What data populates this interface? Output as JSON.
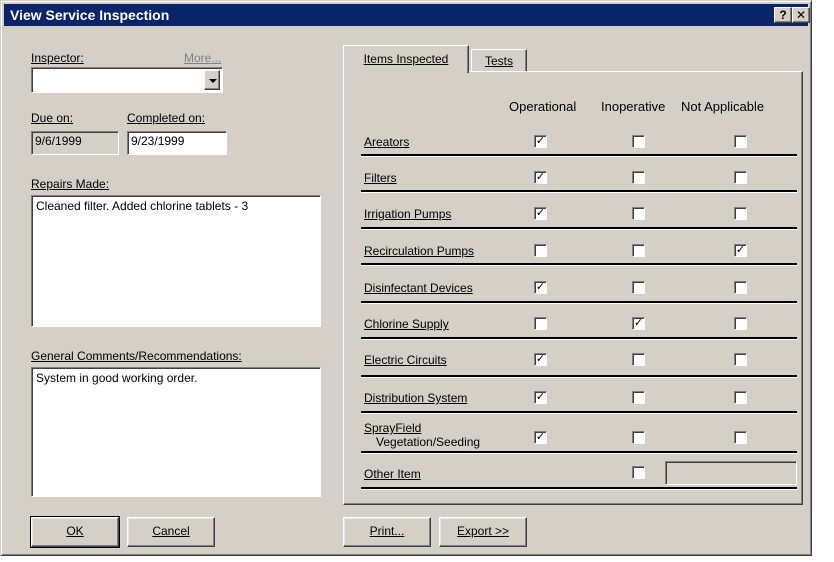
{
  "window": {
    "title": "View Service Inspection",
    "help_label": "?",
    "close_label": "✕"
  },
  "form": {
    "inspector_label": "Inspector:",
    "more_link": "More...",
    "inspector_value": "",
    "due_label": "Due on:",
    "due_value": "9/6/1999",
    "completed_label": "Completed on:",
    "completed_value": "9/23/1999",
    "repairs_label": "Repairs Made:",
    "repairs_value": "Cleaned filter.  Added chlorine tablets - 3",
    "comments_label": "General Comments/Recommendations:",
    "comments_value": "System in good working order."
  },
  "tabs": [
    {
      "label": "Items Inspected",
      "active": true
    },
    {
      "label": "Tests",
      "active": false
    }
  ],
  "columns": [
    "Operational",
    "Inoperative",
    "Not Applicable"
  ],
  "items": [
    {
      "label": "Areators",
      "operational": true,
      "inoperative": false,
      "not_applicable": false
    },
    {
      "label": "Filters",
      "operational": true,
      "inoperative": false,
      "not_applicable": false
    },
    {
      "label": "Irrigation Pumps",
      "operational": true,
      "inoperative": false,
      "not_applicable": false
    },
    {
      "label": "Recirculation Pumps",
      "operational": false,
      "inoperative": false,
      "not_applicable": true
    },
    {
      "label": "Disinfectant Devices",
      "operational": true,
      "inoperative": false,
      "not_applicable": false
    },
    {
      "label": "Chlorine Supply",
      "operational": false,
      "inoperative": true,
      "not_applicable": false
    },
    {
      "label": "Electric Circuits",
      "operational": true,
      "inoperative": false,
      "not_applicable": false
    },
    {
      "label": "Distribution System",
      "operational": true,
      "inoperative": false,
      "not_applicable": false
    },
    {
      "label_line1": "SprayField",
      "label_line2": "Vegetation/Seeding",
      "operational": true,
      "inoperative": false,
      "not_applicable": false
    }
  ],
  "other_item": {
    "label": "Other Item",
    "checked": false,
    "text": ""
  },
  "buttons": {
    "ok": "OK",
    "cancel": "Cancel",
    "print": "Print...",
    "export": "Export >>"
  }
}
